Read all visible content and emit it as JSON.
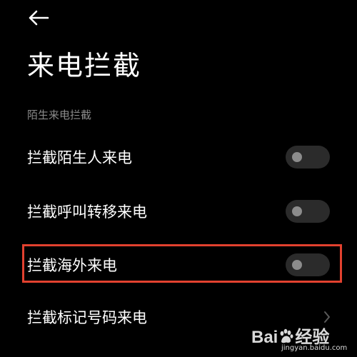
{
  "header": {
    "back_icon": "arrow-left-icon",
    "title": "来电拦截"
  },
  "section": {
    "label": "陌生来电拦截"
  },
  "settings": [
    {
      "label": "拦截陌生人来电",
      "control": "toggle",
      "enabled": false
    },
    {
      "label": "拦截呼叫转移来电",
      "control": "toggle",
      "enabled": false
    },
    {
      "label": "拦截海外来电",
      "control": "toggle",
      "enabled": false,
      "highlighted": true
    },
    {
      "label": "拦截标记号码来电",
      "control": "chevron"
    }
  ],
  "colors": {
    "background": "#000000",
    "text": "#ffffff",
    "section_text": "#8a8a8a",
    "toggle_track": "#2b2b2b",
    "toggle_knob": "#8c8c8c",
    "highlight": "#e2412f"
  },
  "watermark": {
    "brand_left": "Bai",
    "brand_right": "经验",
    "url": "jingyan.baidu.com"
  }
}
